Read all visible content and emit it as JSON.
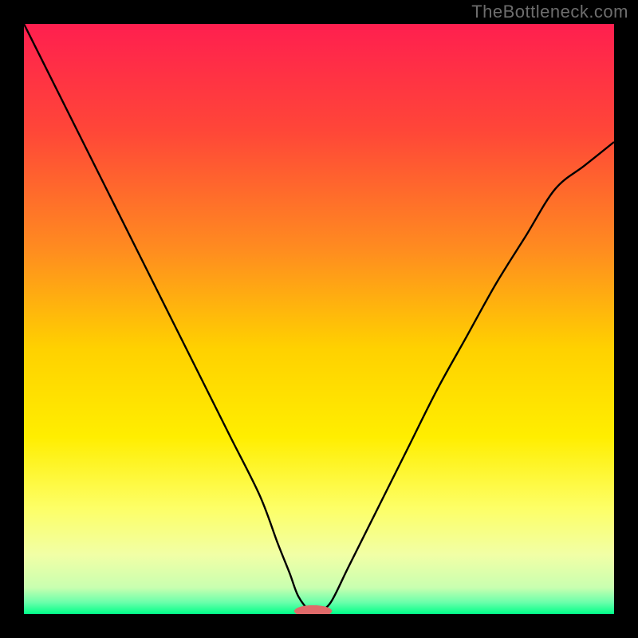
{
  "watermark": "TheBottleneck.com",
  "chart_data": {
    "type": "line",
    "title": "",
    "xlabel": "",
    "ylabel": "",
    "xlim": [
      0,
      100
    ],
    "ylim": [
      0,
      100
    ],
    "background_gradient": {
      "stops": [
        {
          "offset": 0.0,
          "color": "#ff1f4f"
        },
        {
          "offset": 0.18,
          "color": "#ff4638"
        },
        {
          "offset": 0.38,
          "color": "#ff8b20"
        },
        {
          "offset": 0.55,
          "color": "#ffd100"
        },
        {
          "offset": 0.7,
          "color": "#ffee00"
        },
        {
          "offset": 0.82,
          "color": "#fdff66"
        },
        {
          "offset": 0.9,
          "color": "#f1ffa6"
        },
        {
          "offset": 0.955,
          "color": "#c9ffb0"
        },
        {
          "offset": 0.98,
          "color": "#6bffab"
        },
        {
          "offset": 1.0,
          "color": "#00ff88"
        }
      ]
    },
    "series": [
      {
        "name": "bottleneck-curve",
        "color": "#000000",
        "x": [
          0,
          5,
          10,
          15,
          20,
          25,
          30,
          35,
          40,
          43,
          45,
          46.5,
          48.5,
          50,
          52,
          55,
          60,
          65,
          70,
          75,
          80,
          85,
          90,
          95,
          100
        ],
        "y": [
          100,
          90,
          80,
          70,
          60,
          50,
          40,
          30,
          20,
          12,
          7,
          3,
          0.5,
          0.5,
          2,
          8,
          18,
          28,
          38,
          47,
          56,
          64,
          72,
          76,
          80
        ]
      }
    ],
    "marker": {
      "name": "optimal-point",
      "shape": "pill",
      "color": "#e06a6a",
      "cx": 49,
      "cy": 0.5,
      "rx": 3.2,
      "ry": 1.0
    }
  }
}
